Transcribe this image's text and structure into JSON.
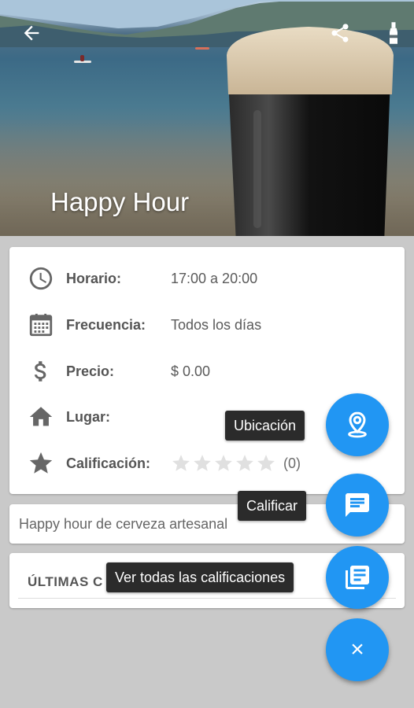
{
  "header": {
    "title": "Happy Hour",
    "back_icon": "arrow-back-icon",
    "share_icon": "share-icon",
    "extra_icon": "bottle-icon"
  },
  "info": {
    "rows": [
      {
        "icon": "clock-icon",
        "label": "Horario:",
        "value": "17:00 a 20:00"
      },
      {
        "icon": "calendar-icon",
        "label": "Frecuencia:",
        "value": "Todos los días"
      },
      {
        "icon": "dollar-icon",
        "label": "Precio:",
        "value": "$ 0.00"
      },
      {
        "icon": "home-icon",
        "label": "Lugar:",
        "value": ""
      },
      {
        "icon": "star-icon",
        "label": "Calificación:",
        "value": ""
      }
    ],
    "rating": {
      "stars": 0,
      "max": 5,
      "count": "(0)"
    }
  },
  "description": "Happy hour de cerveza artesanal",
  "ultimas": {
    "title": "ÚLTIMAS C"
  },
  "fabs": {
    "ubicacion": "Ubicación",
    "calificar": "Calificar",
    "ver_todas": "Ver todas las calificaciones",
    "close": "×"
  },
  "colors": {
    "accent": "#2196f3",
    "tooltip": "#2b2b2b",
    "label": "#555555"
  }
}
